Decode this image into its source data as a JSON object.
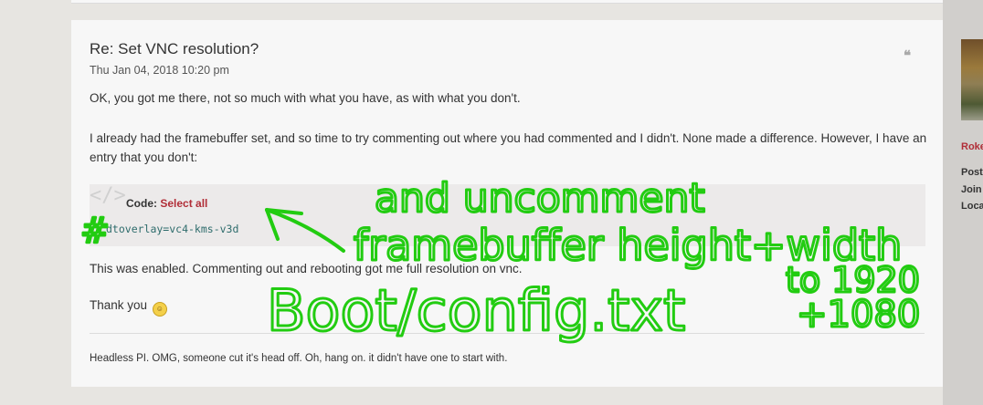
{
  "post": {
    "title": "Re: Set VNC resolution?",
    "date": "Thu Jan 04, 2018 10:20 pm",
    "para1": "OK, you got me there, not so much with what you have, as with what you don't.",
    "para2": "I already had the framebuffer set, and so time to try commenting out where you had commented and I didn't. None made a difference. However, I have an entry that you don't:",
    "code": {
      "label": "Code:",
      "select_all": "Select all",
      "line": "dtoverlay=vc4-kms-v3d"
    },
    "para3": "This was enabled. Commenting out and rebooting got me full resolution on vnc.",
    "para4": "Thank you",
    "signature": "Headless PI. OMG, someone cut it's head off. Oh, hang on. it didn't have one to start with."
  },
  "profile": {
    "username": "Roke",
    "info1": "Post",
    "info2": "Join",
    "info3": "Loca"
  },
  "annotation": {
    "line1": "and uncomment",
    "line2": "framebuffer height+width",
    "line3": "to 1920",
    "line4": "Boot/config.txt",
    "line5": "+1080",
    "hash": "#"
  },
  "colors": {
    "annotation": "#22cc11",
    "link": "#b12e38",
    "code_text": "#2e6c6c"
  }
}
